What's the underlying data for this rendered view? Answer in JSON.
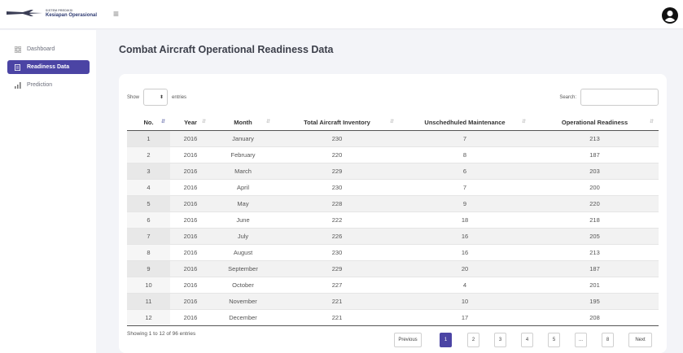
{
  "header": {
    "logo_small": "SISTEM PREDIKSI",
    "logo_big": "Kesiapan Operasional"
  },
  "sidebar": {
    "items": [
      {
        "label": "Dashboard",
        "icon": "dashboard-grid-icon"
      },
      {
        "label": "Readiness Data",
        "icon": "document-icon"
      },
      {
        "label": "Prediction",
        "icon": "bar-chart-icon"
      }
    ],
    "active_color": "#4b44a4"
  },
  "page": {
    "title": "Combat Aircraft Operational Readiness Data"
  },
  "controls": {
    "show_label": "Show",
    "entries_label": "entries",
    "search_label": "Search:"
  },
  "table": {
    "headers": [
      "No.",
      "Year",
      "Month",
      "Total Aircraft Inventory",
      "Unschedhuled Maintenance",
      "Operational Readiness"
    ],
    "rows": [
      [
        "1",
        "2016",
        "January",
        "230",
        "7",
        "213"
      ],
      [
        "2",
        "2016",
        "February",
        "220",
        "8",
        "187"
      ],
      [
        "3",
        "2016",
        "March",
        "229",
        "6",
        "203"
      ],
      [
        "4",
        "2016",
        "April",
        "230",
        "7",
        "200"
      ],
      [
        "5",
        "2016",
        "May",
        "228",
        "9",
        "220"
      ],
      [
        "6",
        "2016",
        "June",
        "222",
        "18",
        "218"
      ],
      [
        "7",
        "2016",
        "July",
        "226",
        "16",
        "205"
      ],
      [
        "8",
        "2016",
        "August",
        "230",
        "16",
        "213"
      ],
      [
        "9",
        "2016",
        "September",
        "229",
        "20",
        "187"
      ],
      [
        "10",
        "2016",
        "October",
        "227",
        "4",
        "201"
      ],
      [
        "11",
        "2016",
        "November",
        "221",
        "10",
        "195"
      ],
      [
        "12",
        "2016",
        "December",
        "221",
        "17",
        "208"
      ]
    ]
  },
  "footer": {
    "info": "Showing 1 to 12 of 96 entries",
    "pagination": {
      "previous": "Previous",
      "pages": [
        "1",
        "2",
        "3",
        "4",
        "5",
        "...",
        "8"
      ],
      "next": "Next",
      "current": "1"
    }
  }
}
